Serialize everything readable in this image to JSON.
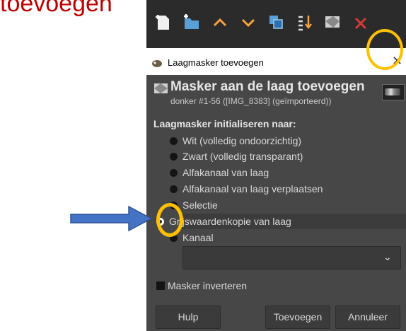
{
  "slide": {
    "heading": "toevoegen"
  },
  "toolbar": {
    "icons": [
      "new-layer-icon",
      "new-layer-group-icon",
      "raise-layer-icon",
      "lower-layer-icon",
      "duplicate-layer-icon",
      "anchor-layer-icon",
      "mask-icon",
      "delete-layer-icon"
    ]
  },
  "dialog": {
    "window_title": "Laagmasker toevoegen",
    "header_title": "Masker aan de laag toevoegen",
    "header_subtitle": "donker #1-56 ([IMG_8383] (geïmporteerd))",
    "section_label": "Laagmasker initialiseren naar:",
    "options": [
      {
        "label": "Wit (volledig ondoorzichtig)",
        "selected": false
      },
      {
        "label": "Zwart (volledig transparant)",
        "selected": false
      },
      {
        "label": "Alfakanaal van laag",
        "selected": false
      },
      {
        "label": "Alfakanaal van laag verplaatsen",
        "selected": false
      },
      {
        "label": "Selectie",
        "selected": false
      },
      {
        "label": "Grijswaardenkopie van laag",
        "selected": true
      },
      {
        "label": "Kanaal",
        "selected": false
      }
    ],
    "channel_value": "",
    "invert_label": "Masker inverteren",
    "invert_checked": false,
    "buttons": {
      "help": "Hulp",
      "add": "Toevoegen",
      "cancel": "Annuleer"
    }
  },
  "colors": {
    "annotation_circle": "#ffc000",
    "annotation_arrow": "#4472c4",
    "heading": "#c00000"
  }
}
